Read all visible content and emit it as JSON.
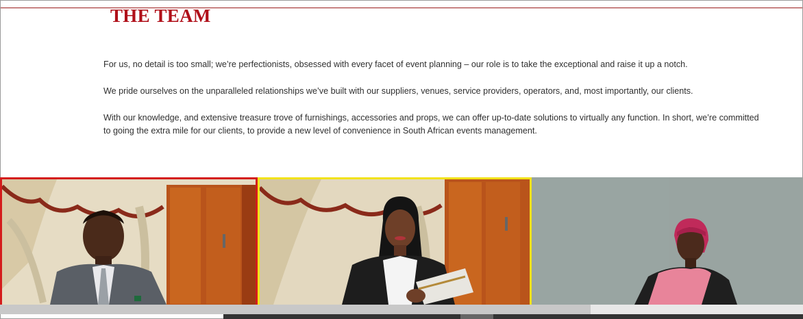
{
  "section": {
    "title": "THE TEAM"
  },
  "intro": {
    "paragraphs": [
      "For us, no detail is too small; we’re perfectionists, obsessed with every facet of event planning – our role is to take the exceptional and raise it up a notch.",
      "We pride ourselves on the unparalleled relationships we’ve built with our suppliers, venues, service providers, operators, and, most importantly, our clients.",
      "With our knowledge, and extensive treasure trove of furnishings, accessories and props, we can offer up-to-date solutions to virtually any function. In short, we’re committed to going the extra mile for our clients, to provide a new level of convenience in South African events management."
    ]
  },
  "team_gallery": {
    "members": [
      {
        "photo": "man-in-suit-photo",
        "frame_color": "#d41c1c"
      },
      {
        "photo": "woman-with-folder-photo",
        "frame_color": "#f2e21a"
      },
      {
        "photo": "woman-in-pink-headwrap-photo",
        "frame_color": "none"
      }
    ]
  },
  "colors": {
    "accent": "#b0101a",
    "text": "#2f2f2f"
  }
}
